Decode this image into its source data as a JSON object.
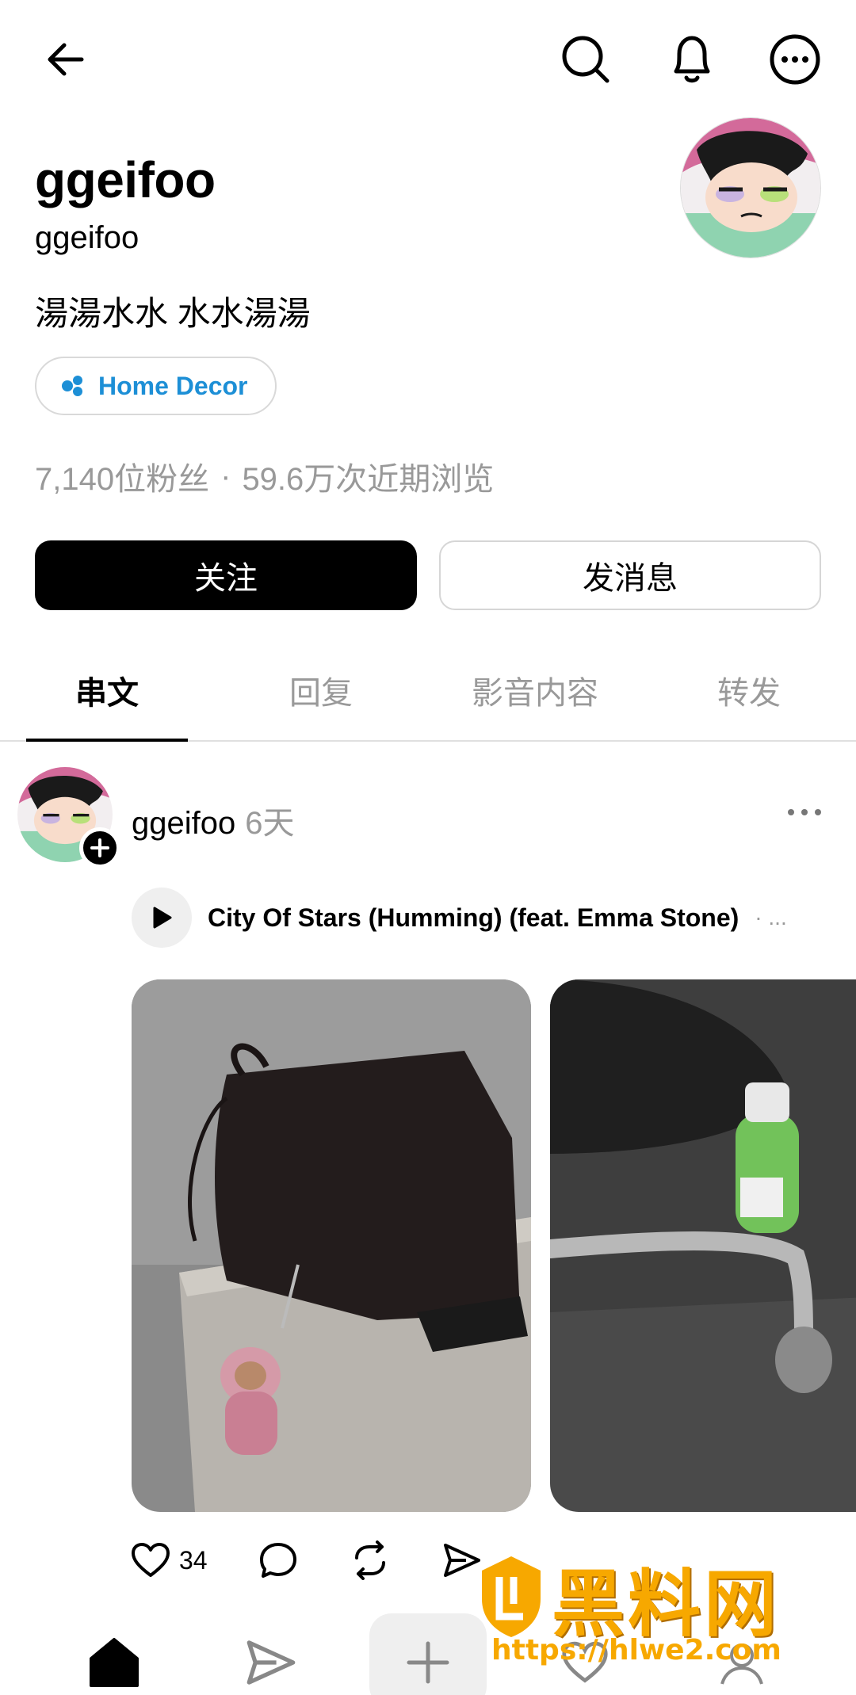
{
  "profile": {
    "display_name": "ggeifoo",
    "handle": "ggeifoo",
    "bio": "湯湯水水 水水湯湯",
    "tag_label": "Home Decor",
    "followers": "7,140位粉丝",
    "views": "59.6万次近期浏览",
    "separator": "·"
  },
  "buttons": {
    "follow": "关注",
    "message": "发消息"
  },
  "tabs": [
    {
      "label": "串文",
      "active": true
    },
    {
      "label": "回复",
      "active": false
    },
    {
      "label": "影音内容",
      "active": false
    },
    {
      "label": "转发",
      "active": false
    }
  ],
  "post": {
    "username": "ggeifoo",
    "time": "6天",
    "music_title": "City Of Stars (Humming) (feat. Emma Stone)",
    "music_more": "· ...",
    "likes": "34"
  },
  "watermark": {
    "text": "黑料网",
    "url": "https://hlwe2.com"
  },
  "colors": {
    "accent_blue": "#1d8fd6",
    "muted_gray": "#999999",
    "watermark_orange": "#f7a800"
  },
  "icons": [
    "back-arrow-icon",
    "search-icon",
    "bell-icon",
    "more-icon",
    "heart-icon",
    "comment-icon",
    "repost-icon",
    "share-icon",
    "home-icon",
    "send-icon",
    "plus-icon",
    "profile-icon"
  ]
}
